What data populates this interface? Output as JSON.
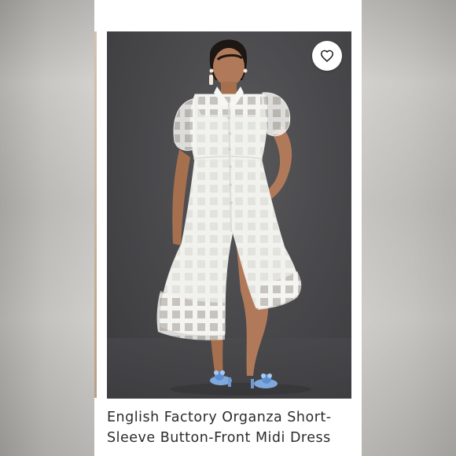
{
  "listing": {
    "title": "English Factory Organza Short-Sleeve Button-Front Midi Dress",
    "photo_alt": "Model wearing white grid organza short-sleeve button-front midi dress with blue flower sandals"
  },
  "icons": {
    "favorite": "heart-outline-icon"
  },
  "colors": {
    "photo_background": "#4a4a4d",
    "dress": "#f4f4f1",
    "sandals": "#7fa9dc",
    "text": "#2b2b2b"
  }
}
